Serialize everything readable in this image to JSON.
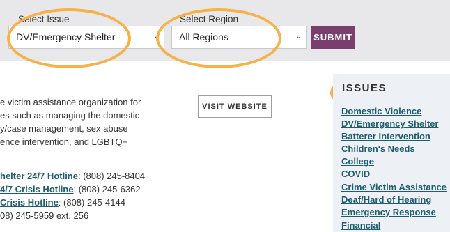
{
  "filters": {
    "issue_label": "Select Issue",
    "issue_value": "DV/Emergency Shelter",
    "region_label": "Select Region",
    "region_value": "All Regions",
    "submit_label": "SUBMIT"
  },
  "description_lines": [
    "e victim assistance organization for",
    "es such as managing the domestic",
    "y/case management, sex abuse",
    "ence intervention, and LGBTQ+"
  ],
  "visit_label": "VISIT WEBSITE",
  "contacts": [
    {
      "link": "helter 24/7 Hotline",
      "text": ": (808) 245-8404"
    },
    {
      "link": "4/7 Crisis Hotline",
      "text": ": (808) 245-6362"
    },
    {
      "link": "Crisis Hotline",
      "text": ": (808) 245-4144"
    },
    {
      "link": "",
      "text": "08) 245-5959 ext. 256"
    }
  ],
  "issues": {
    "heading": "ISSUES",
    "items": [
      "Domestic Violence",
      "DV/Emergency Shelter",
      "Batterer Intervention",
      "Children's Needs",
      "College",
      "COVID",
      "Crime Victim Assistance",
      "Deaf/Hard of Hearing",
      "Emergency Response",
      "Financial"
    ]
  },
  "colors": {
    "submit_bg": "#7a3e6e",
    "link": "#1e5d6f",
    "highlight_ring": "#f5b14a",
    "filter_bar_bg": "#e8e8ea",
    "issues_panel_bg": "#edf0f5"
  }
}
